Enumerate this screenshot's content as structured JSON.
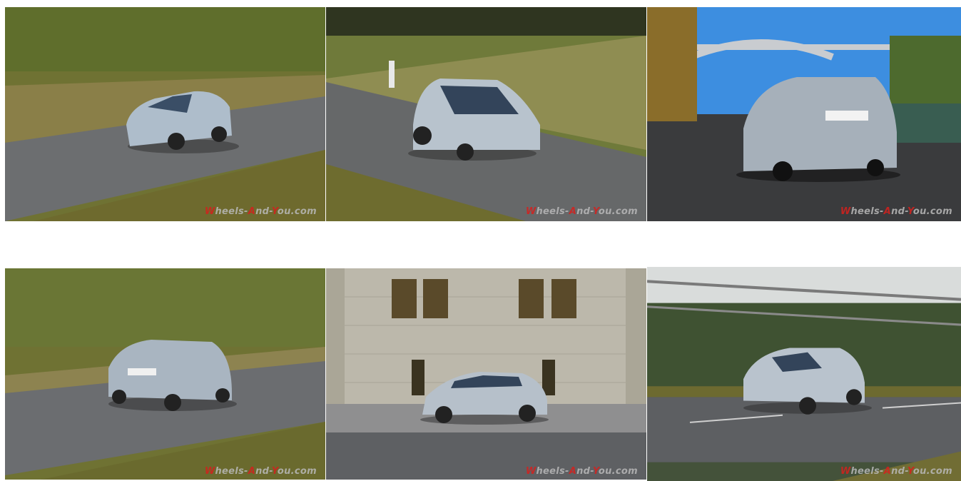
{
  "gallery": {
    "watermark": {
      "prefix": "W",
      "part1": "heels-",
      "mid": "A",
      "part2": "nd-",
      "end": "Y",
      "part3": "ou.com"
    },
    "images": [
      {
        "subject": "Silver Opel Ampera-e driving on curved road, front three-quarter, motion blur"
      },
      {
        "subject": "Silver Opel Ampera-e driving uphill road, front three-quarter"
      },
      {
        "subject": "Silver Opel Ampera-e rear three-quarter under steel arch bridge"
      },
      {
        "subject": "Silver Opel Ampera-e rear three-quarter on curved road"
      },
      {
        "subject": "Silver Opel Ampera-e side profile parked before stone building"
      },
      {
        "subject": "Silver Opel Ampera-e front three-quarter driving past orchard"
      }
    ],
    "colors": {
      "car": "#b8c2cc",
      "road": "#5f6163",
      "grass": "#7a7a3a",
      "sky": "#3d8ee0"
    }
  }
}
